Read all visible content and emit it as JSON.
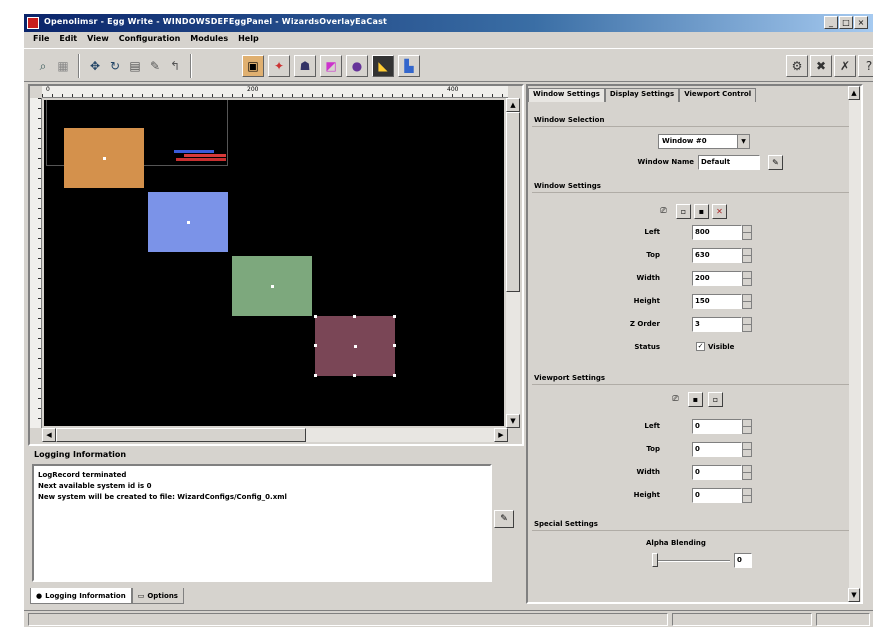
{
  "window": {
    "title": "Openolimsr - Egg Write - WINDOWSDEFEggPanel - WizardsOverlayEaCast"
  },
  "menu": [
    "File",
    "Edit",
    "View",
    "Configuration",
    "Modules",
    "Help"
  ],
  "canvas": {
    "ruler_labels": [
      "0",
      "200",
      "400"
    ],
    "windows": [
      {
        "id": "orange",
        "color": "#d4914c"
      },
      {
        "id": "blue",
        "color": "#7b93e8"
      },
      {
        "id": "green",
        "color": "#7da87d"
      },
      {
        "id": "mauve",
        "color": "#7a4656"
      }
    ]
  },
  "logging": {
    "header": "Logging Information",
    "lines": [
      "LogRecord terminated",
      "Next available system id is 0",
      "New system will be created to file: WizardConfigs/Config_0.xml"
    ]
  },
  "bottom_tabs": [
    "Logging Information",
    "Options"
  ],
  "panel": {
    "tabs": [
      "Window Settings",
      "Display Settings",
      "Viewport Control"
    ],
    "window_selection": {
      "title": "Window Selection",
      "selected": "Window #0",
      "name_label": "Window Name",
      "name_value": "Default"
    },
    "window_settings": {
      "title": "Window Settings",
      "fields": [
        {
          "label": "Left",
          "value": "800"
        },
        {
          "label": "Top",
          "value": "630"
        },
        {
          "label": "Width",
          "value": "200"
        },
        {
          "label": "Height",
          "value": "150"
        },
        {
          "label": "Z Order",
          "value": "3"
        }
      ],
      "status_label": "Status",
      "status_check_label": "Visible"
    },
    "viewport_settings": {
      "title": "Viewport Settings",
      "fields": [
        {
          "label": "Left",
          "value": "0"
        },
        {
          "label": "Top",
          "value": "0"
        },
        {
          "label": "Width",
          "value": "0"
        },
        {
          "label": "Height",
          "value": "0"
        }
      ]
    },
    "special_settings": {
      "title": "Special Settings",
      "alpha_label": "Alpha Blending",
      "alpha_value": "0"
    }
  }
}
